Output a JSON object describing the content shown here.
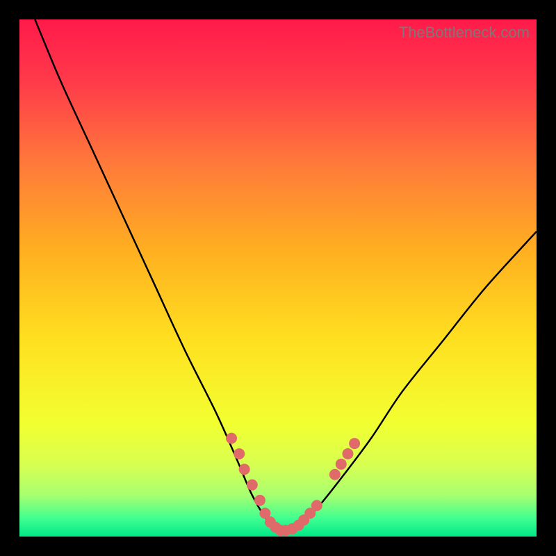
{
  "watermark": "TheBottleneck.com",
  "chart_data": {
    "type": "line",
    "title": "",
    "xlabel": "",
    "ylabel": "",
    "xlim": [
      0,
      100
    ],
    "ylim": [
      0,
      100
    ],
    "grid": false,
    "series": [
      {
        "name": "curve",
        "x": [
          3,
          8,
          14,
          20,
          26,
          32,
          38,
          42,
          45,
          48,
          50,
          52,
          55,
          58,
          62,
          68,
          74,
          82,
          90,
          100
        ],
        "y": [
          100,
          88,
          75,
          62,
          49,
          36,
          24,
          15,
          8,
          3,
          1,
          1,
          3,
          6,
          11,
          19,
          28,
          38,
          48,
          59
        ]
      }
    ],
    "scatter_points": {
      "name": "highlight",
      "x": [
        41,
        42.5,
        43.5,
        45,
        46.5,
        47.5,
        48.5,
        49.5,
        50.5,
        51.5,
        52.8,
        54,
        55,
        56.2,
        57.5,
        61,
        62.2,
        63.5,
        64.8
      ],
      "y": [
        19,
        16,
        13,
        10,
        7,
        4.5,
        2.8,
        1.8,
        1.2,
        1.2,
        1.5,
        2.2,
        3.2,
        4.5,
        6,
        12,
        14,
        16,
        18
      ]
    },
    "gradient_stops": [
      {
        "offset": 0.0,
        "color": "#ff1a4a"
      },
      {
        "offset": 0.12,
        "color": "#ff3a4a"
      },
      {
        "offset": 0.28,
        "color": "#ff7a3a"
      },
      {
        "offset": 0.45,
        "color": "#ffb020"
      },
      {
        "offset": 0.62,
        "color": "#ffe020"
      },
      {
        "offset": 0.78,
        "color": "#f2ff30"
      },
      {
        "offset": 0.86,
        "color": "#d8ff50"
      },
      {
        "offset": 0.92,
        "color": "#a8ff70"
      },
      {
        "offset": 0.965,
        "color": "#40ff90"
      },
      {
        "offset": 1.0,
        "color": "#00e888"
      }
    ],
    "curve_color": "#000000",
    "point_color": "#e06a6a",
    "point_radius": 8
  }
}
